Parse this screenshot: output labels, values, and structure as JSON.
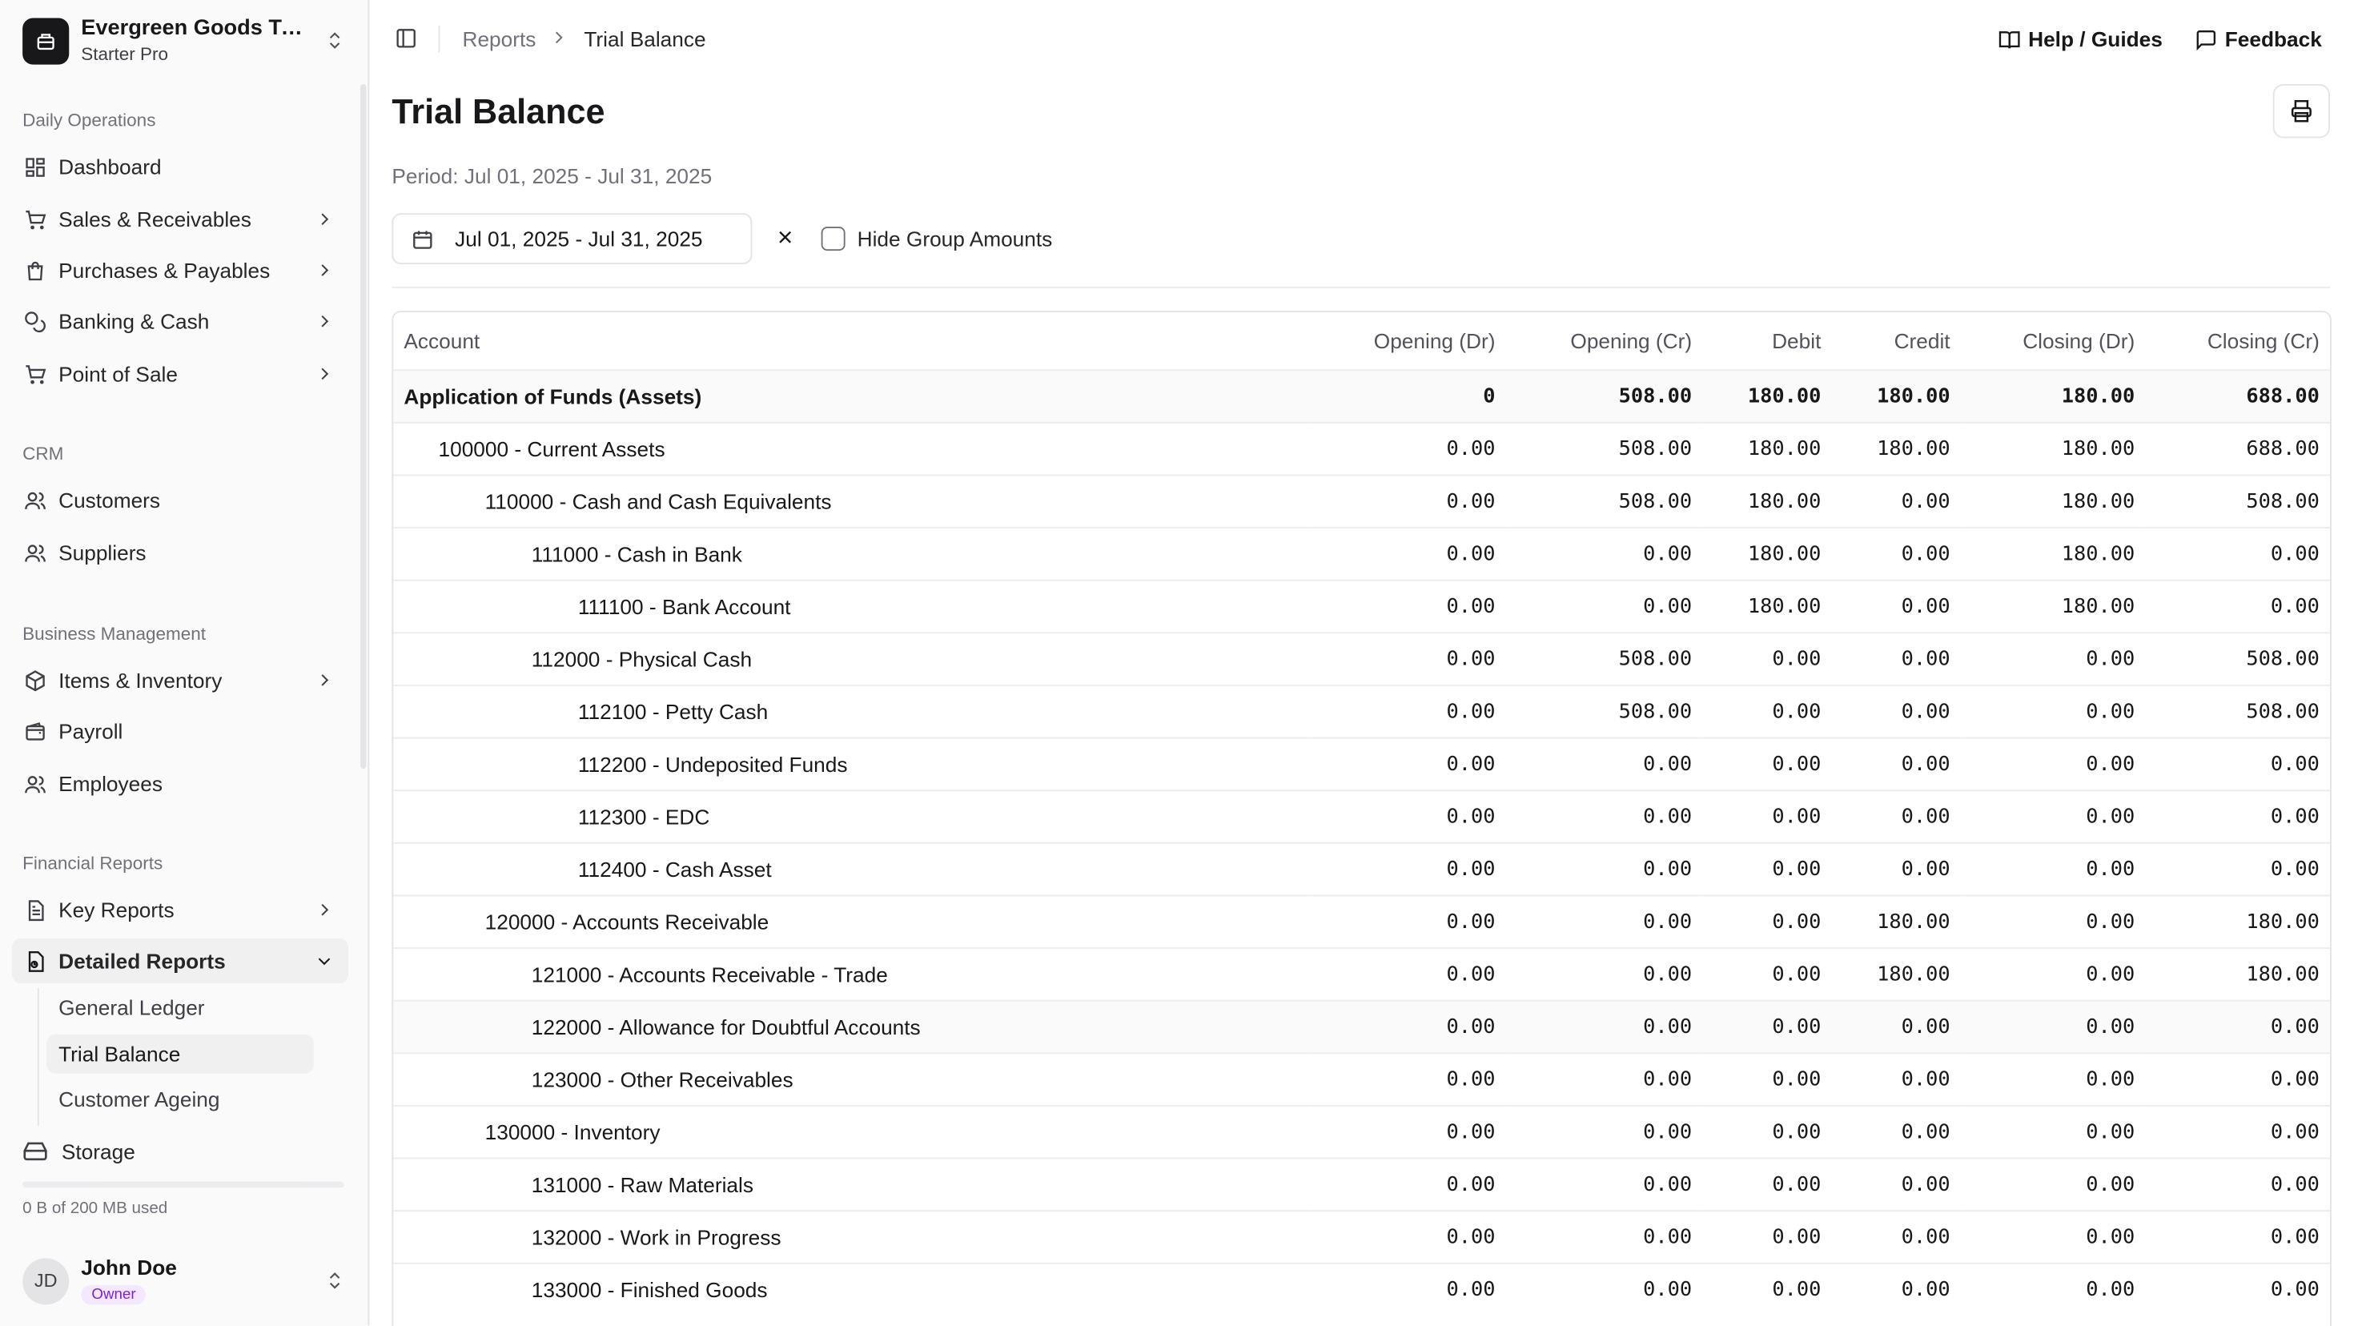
{
  "org": {
    "name": "Evergreen Goods Tra...",
    "plan": "Starter Pro"
  },
  "sidebar": {
    "sections": [
      {
        "label": "Daily Operations"
      },
      {
        "label": "CRM"
      },
      {
        "label": "Business Management"
      },
      {
        "label": "Financial Reports"
      }
    ],
    "items": {
      "dashboard": "Dashboard",
      "sales": "Sales & Receivables",
      "purchases": "Purchases & Payables",
      "banking": "Banking & Cash",
      "pos": "Point of Sale",
      "customers": "Customers",
      "suppliers": "Suppliers",
      "items": "Items & Inventory",
      "payroll": "Payroll",
      "employees": "Employees",
      "key_reports": "Key Reports",
      "detailed_reports": "Detailed Reports"
    },
    "sub_items": {
      "general_ledger": "General Ledger",
      "trial_balance": "Trial Balance",
      "customer_ageing": "Customer Ageing"
    },
    "storage": {
      "label": "Storage",
      "used_text": "0 B of 200 MB used",
      "used_fraction": 0
    },
    "user": {
      "initials": "JD",
      "name": "John Doe",
      "role": "Owner"
    }
  },
  "topbar": {
    "breadcrumb": [
      "Reports",
      "Trial Balance"
    ],
    "help_label": "Help / Guides",
    "feedback_label": "Feedback"
  },
  "page": {
    "title": "Trial Balance",
    "period": "Period: Jul 01, 2025 - Jul 31, 2025",
    "date_range": "Jul 01, 2025 - Jul 31, 2025",
    "hide_group_label": "Hide Group Amounts",
    "hide_group_checked": false
  },
  "table": {
    "columns": [
      "Account",
      "Opening (Dr)",
      "Opening (Cr)",
      "Debit",
      "Credit",
      "Closing (Dr)",
      "Closing (Cr)"
    ],
    "rows": [
      {
        "account": "Application of Funds (Assets)",
        "level": 0,
        "values": [
          "0",
          "508.00",
          "180.00",
          "180.00",
          "180.00",
          "688.00"
        ]
      },
      {
        "account": "100000 - Current Assets",
        "level": 1,
        "values": [
          "0.00",
          "508.00",
          "180.00",
          "180.00",
          "180.00",
          "688.00"
        ]
      },
      {
        "account": "110000 - Cash and Cash Equivalents",
        "level": 2,
        "values": [
          "0.00",
          "508.00",
          "180.00",
          "0.00",
          "180.00",
          "508.00"
        ]
      },
      {
        "account": "111000 - Cash in Bank",
        "level": 3,
        "values": [
          "0.00",
          "0.00",
          "180.00",
          "0.00",
          "180.00",
          "0.00"
        ]
      },
      {
        "account": "111100 - Bank Account",
        "level": 4,
        "values": [
          "0.00",
          "0.00",
          "180.00",
          "0.00",
          "180.00",
          "0.00"
        ]
      },
      {
        "account": "112000 - Physical Cash",
        "level": 3,
        "values": [
          "0.00",
          "508.00",
          "0.00",
          "0.00",
          "0.00",
          "508.00"
        ]
      },
      {
        "account": "112100 - Petty Cash",
        "level": 4,
        "values": [
          "0.00",
          "508.00",
          "0.00",
          "0.00",
          "0.00",
          "508.00"
        ]
      },
      {
        "account": "112200 - Undeposited Funds",
        "level": 4,
        "values": [
          "0.00",
          "0.00",
          "0.00",
          "0.00",
          "0.00",
          "0.00"
        ]
      },
      {
        "account": "112300 - EDC",
        "level": 4,
        "values": [
          "0.00",
          "0.00",
          "0.00",
          "0.00",
          "0.00",
          "0.00"
        ]
      },
      {
        "account": "112400 - Cash Asset",
        "level": 4,
        "values": [
          "0.00",
          "0.00",
          "0.00",
          "0.00",
          "0.00",
          "0.00"
        ]
      },
      {
        "account": "120000 - Accounts Receivable",
        "level": 2,
        "values": [
          "0.00",
          "0.00",
          "0.00",
          "180.00",
          "0.00",
          "180.00"
        ]
      },
      {
        "account": "121000 - Accounts Receivable - Trade",
        "level": 3,
        "values": [
          "0.00",
          "0.00",
          "0.00",
          "180.00",
          "0.00",
          "180.00"
        ]
      },
      {
        "account": "122000 - Allowance for Doubtful Accounts",
        "level": 3,
        "highlight": true,
        "values": [
          "0.00",
          "0.00",
          "0.00",
          "0.00",
          "0.00",
          "0.00"
        ]
      },
      {
        "account": "123000 - Other Receivables",
        "level": 3,
        "values": [
          "0.00",
          "0.00",
          "0.00",
          "0.00",
          "0.00",
          "0.00"
        ]
      },
      {
        "account": "130000 - Inventory",
        "level": 2,
        "values": [
          "0.00",
          "0.00",
          "0.00",
          "0.00",
          "0.00",
          "0.00"
        ]
      },
      {
        "account": "131000 - Raw Materials",
        "level": 3,
        "values": [
          "0.00",
          "0.00",
          "0.00",
          "0.00",
          "0.00",
          "0.00"
        ]
      },
      {
        "account": "132000 - Work in Progress",
        "level": 3,
        "values": [
          "0.00",
          "0.00",
          "0.00",
          "0.00",
          "0.00",
          "0.00"
        ]
      },
      {
        "account": "133000 - Finished Goods",
        "level": 3,
        "values": [
          "0.00",
          "0.00",
          "0.00",
          "0.00",
          "0.00",
          "0.00"
        ]
      }
    ]
  }
}
